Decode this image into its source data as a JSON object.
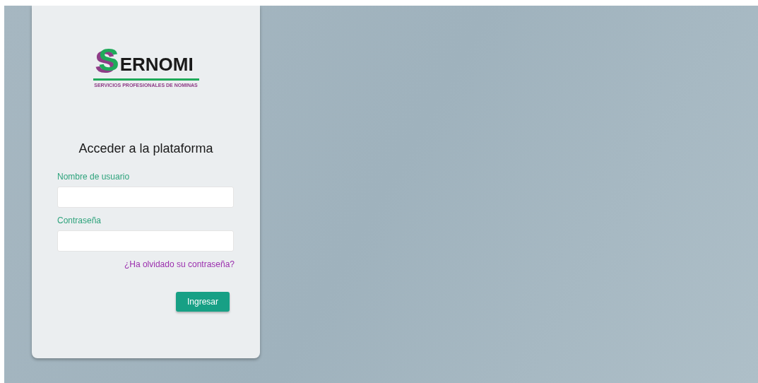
{
  "logo": {
    "wordmark": "SERNOMI",
    "tagline": "SERVICIOS PROFESIONALES DE NOMINAS"
  },
  "login": {
    "title": "Acceder a la plataforma",
    "fields": [
      {
        "label": "Nombre de usuario"
      },
      {
        "label": "Contraseña"
      }
    ],
    "forgot_link": "¿Ha olvidado su contraseña?",
    "submit": "Ingresar"
  }
}
